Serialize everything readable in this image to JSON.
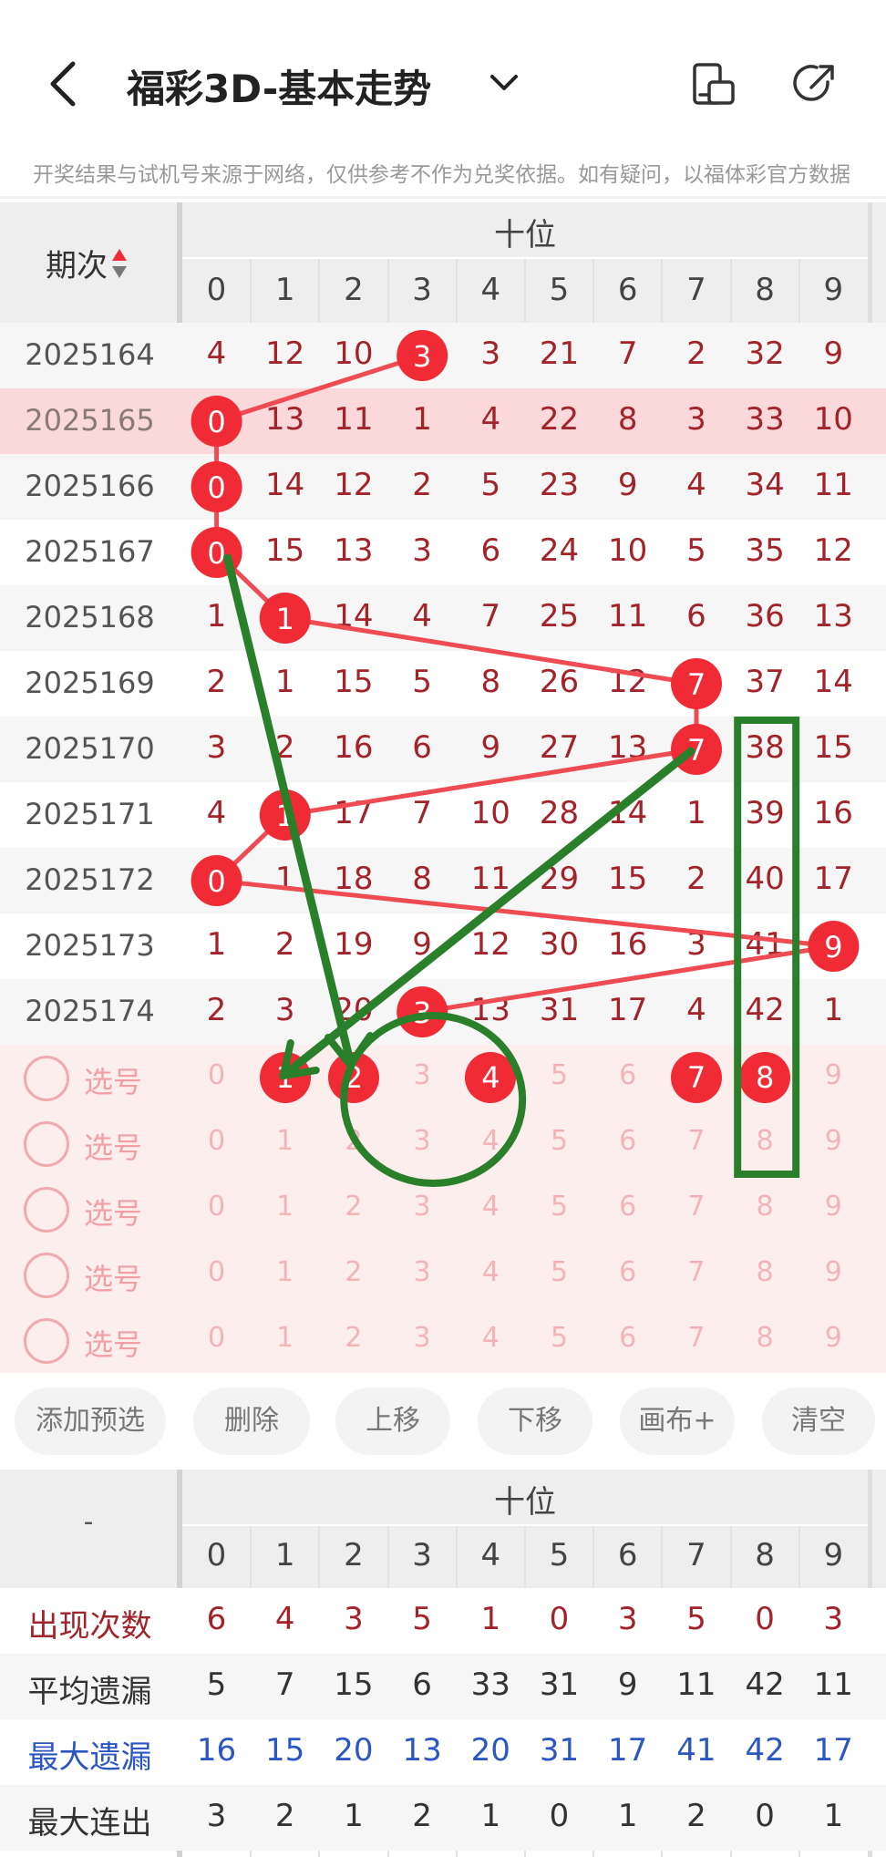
{
  "header": {
    "title": "福彩3D-基本走势",
    "back_icon": "chevron-left-icon",
    "dropdown_icon": "chevron-down-icon",
    "layout_icon": "layout-icon",
    "share_icon": "share-icon"
  },
  "notice": "开奖结果与试机号来源于网络，仅供参考不作为兑奖依据。如有疑问，以福体彩官方数据",
  "table": {
    "period_header": "期次",
    "group_header": "十位",
    "digits": [
      "0",
      "1",
      "2",
      "3",
      "4",
      "5",
      "6",
      "7",
      "8",
      "9"
    ],
    "rows": [
      {
        "period": "2025164",
        "cells": [
          "4",
          "12",
          "10",
          "3",
          "3",
          "21",
          "7",
          "2",
          "32",
          "9"
        ],
        "hit": 3,
        "highlight": false
      },
      {
        "period": "2025165",
        "cells": [
          "0",
          "13",
          "11",
          "1",
          "4",
          "22",
          "8",
          "3",
          "33",
          "10"
        ],
        "hit": 0,
        "highlight": true
      },
      {
        "period": "2025166",
        "cells": [
          "0",
          "14",
          "12",
          "2",
          "5",
          "23",
          "9",
          "4",
          "34",
          "11"
        ],
        "hit": 0,
        "highlight": false
      },
      {
        "period": "2025167",
        "cells": [
          "0",
          "15",
          "13",
          "3",
          "6",
          "24",
          "10",
          "5",
          "35",
          "12"
        ],
        "hit": 0,
        "highlight": false
      },
      {
        "period": "2025168",
        "cells": [
          "1",
          "1",
          "14",
          "4",
          "7",
          "25",
          "11",
          "6",
          "36",
          "13"
        ],
        "hit": 1,
        "highlight": false
      },
      {
        "period": "2025169",
        "cells": [
          "2",
          "1",
          "15",
          "5",
          "8",
          "26",
          "12",
          "7",
          "37",
          "14"
        ],
        "hit": 7,
        "highlight": false
      },
      {
        "period": "2025170",
        "cells": [
          "3",
          "2",
          "16",
          "6",
          "9",
          "27",
          "13",
          "7",
          "38",
          "15"
        ],
        "hit": 7,
        "highlight": false
      },
      {
        "period": "2025171",
        "cells": [
          "4",
          "1",
          "17",
          "7",
          "10",
          "28",
          "14",
          "1",
          "39",
          "16"
        ],
        "hit": 1,
        "highlight": false
      },
      {
        "period": "2025172",
        "cells": [
          "0",
          "1",
          "18",
          "8",
          "11",
          "29",
          "15",
          "2",
          "40",
          "17"
        ],
        "hit": 0,
        "highlight": false
      },
      {
        "period": "2025173",
        "cells": [
          "1",
          "2",
          "19",
          "9",
          "12",
          "30",
          "16",
          "3",
          "41",
          "9"
        ],
        "hit": 9,
        "highlight": false
      },
      {
        "period": "2025174",
        "cells": [
          "2",
          "3",
          "20",
          "3",
          "13",
          "31",
          "17",
          "4",
          "42",
          "1"
        ],
        "hit": 3,
        "highlight": false
      }
    ],
    "select_label": "选号",
    "select_rows": [
      {
        "selected": [
          1,
          2,
          4,
          7,
          8
        ]
      },
      {
        "selected": []
      },
      {
        "selected": []
      },
      {
        "selected": []
      },
      {
        "selected": []
      }
    ]
  },
  "actions": [
    "添加预选",
    "删除",
    "上移",
    "下移",
    "画布+",
    "清空"
  ],
  "stats": {
    "corner": "-",
    "group_header": "十位",
    "digits": [
      "0",
      "1",
      "2",
      "3",
      "4",
      "5",
      "6",
      "7",
      "8",
      "9"
    ],
    "rows": [
      {
        "label": "出现次数",
        "values": [
          "6",
          "4",
          "3",
          "5",
          "1",
          "0",
          "3",
          "5",
          "0",
          "3"
        ],
        "color": "#a3232a",
        "label_color": "#a3232a"
      },
      {
        "label": "平均遗漏",
        "values": [
          "5",
          "7",
          "15",
          "6",
          "33",
          "31",
          "9",
          "11",
          "42",
          "11"
        ],
        "color": "#333333",
        "label_color": "#333333"
      },
      {
        "label": "最大遗漏",
        "values": [
          "16",
          "15",
          "20",
          "13",
          "20",
          "31",
          "17",
          "41",
          "42",
          "17"
        ],
        "color": "#2b56c4",
        "label_color": "#2b56c4"
      },
      {
        "label": "最大连出",
        "values": [
          "3",
          "2",
          "1",
          "2",
          "1",
          "0",
          "1",
          "2",
          "0",
          "1"
        ],
        "color": "#333333",
        "label_color": "#333333"
      }
    ]
  },
  "colors": {
    "accent": "#f02b35",
    "annotation": "#2a7f2a"
  }
}
